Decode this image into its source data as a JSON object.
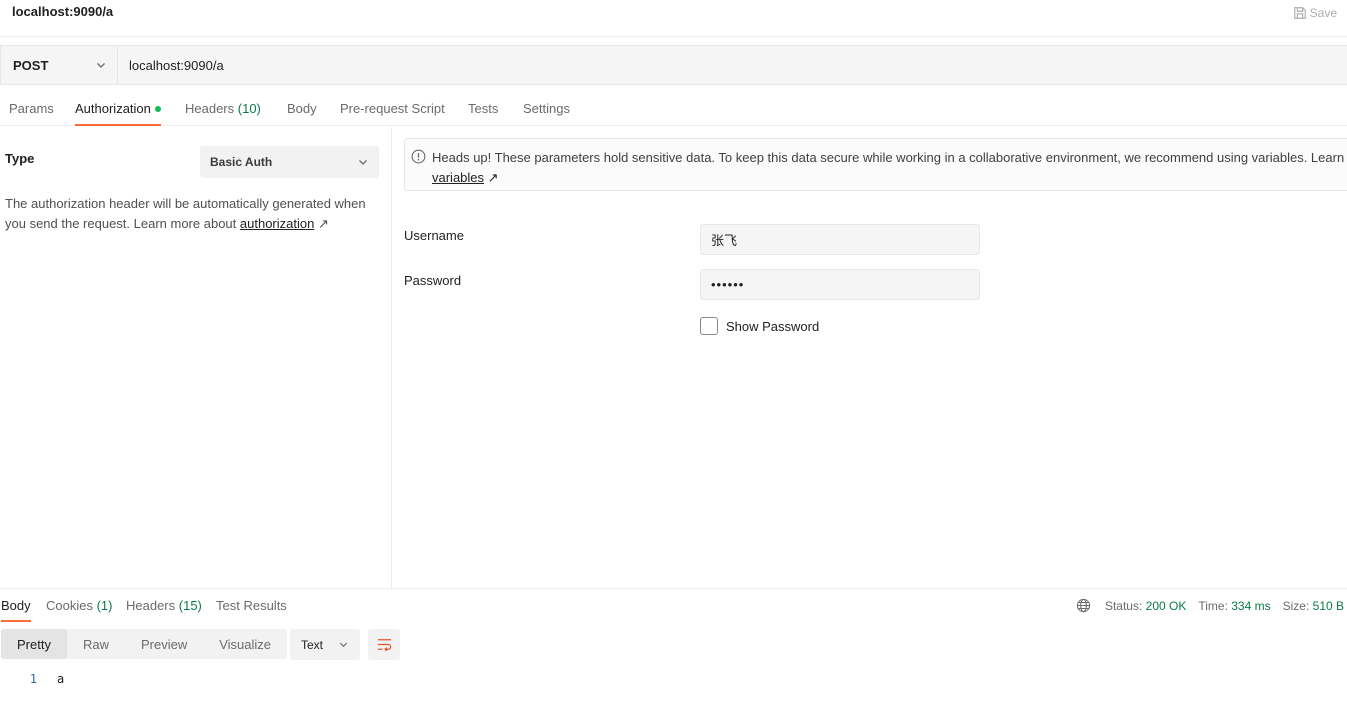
{
  "window": {
    "title": "localhost:9090/a",
    "save_label": "Save"
  },
  "request": {
    "method": "POST",
    "url": "localhost:9090/a"
  },
  "request_tabs": [
    {
      "label": "Params",
      "count": "",
      "active": false
    },
    {
      "label": "Authorization",
      "count": "",
      "active": true,
      "indicator": "green-dot"
    },
    {
      "label": "Headers",
      "count": "(10)",
      "active": false
    },
    {
      "label": "Body",
      "count": "",
      "active": false
    },
    {
      "label": "Pre-request Script",
      "count": "",
      "active": false
    },
    {
      "label": "Tests",
      "count": "",
      "active": false
    },
    {
      "label": "Settings",
      "count": "",
      "active": false
    }
  ],
  "auth": {
    "type_label": "Type",
    "type_value": "Basic Auth",
    "description": "The authorization header will be automatically generated when you send the request. Learn more about ",
    "description_link": "authorization",
    "link_arrow": "↗",
    "banner_text": "Heads up! These parameters hold sensitive data. To keep this data secure while working in a collaborative environment, we recommend using variables. Learn more about",
    "banner_link": "variables",
    "username_label": "Username",
    "username_value": "张飞",
    "password_label": "Password",
    "password_value": "••••••",
    "show_password_label": "Show Password",
    "show_password_checked": false
  },
  "response_tabs": [
    {
      "label": "Body",
      "count": "",
      "active": true
    },
    {
      "label": "Cookies",
      "count": "(1)",
      "active": false
    },
    {
      "label": "Headers",
      "count": "(15)",
      "active": false
    },
    {
      "label": "Test Results",
      "count": "",
      "active": false
    }
  ],
  "response_meta": {
    "status_label": "Status:",
    "status_value": "200 OK",
    "time_label": "Time:",
    "time_value": "334 ms",
    "size_label": "Size:",
    "size_value": "510 B"
  },
  "view_modes": [
    "Pretty",
    "Raw",
    "Preview",
    "Visualize"
  ],
  "active_view_mode": "Pretty",
  "format": "Text",
  "body_lines": [
    {
      "number": "1",
      "text": "a"
    }
  ],
  "colors": {
    "accent": "#ff6c37",
    "success": "#0b7a49",
    "indicator": "#0cbb52"
  },
  "icons": [
    "save-icon",
    "chevron-down-icon",
    "info-icon",
    "globe-icon",
    "wrap-lines-icon"
  ]
}
